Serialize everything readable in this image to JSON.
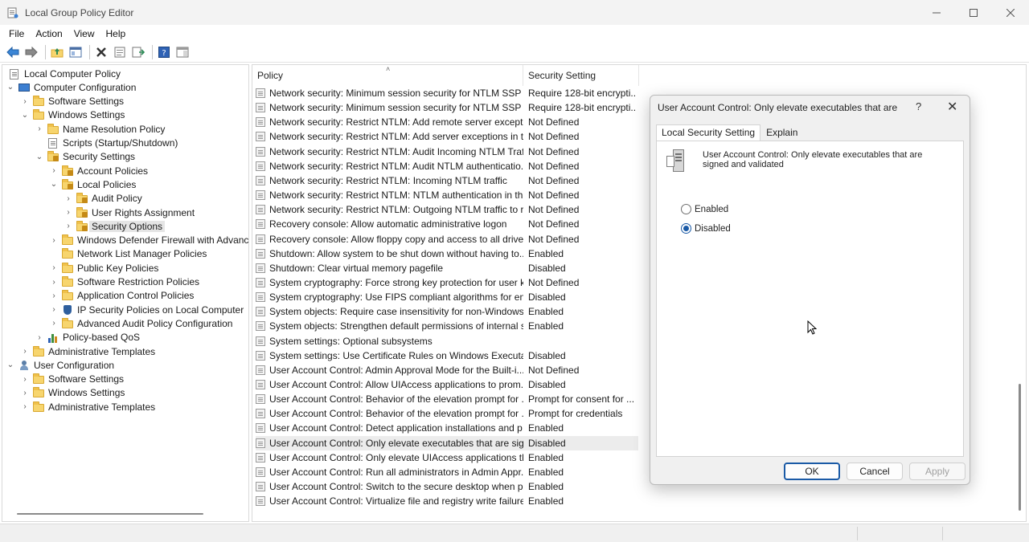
{
  "window": {
    "title": "Local Group Policy Editor"
  },
  "menu": [
    "File",
    "Action",
    "View",
    "Help"
  ],
  "tree": [
    {
      "label": "Local Computer Policy",
      "level": 0,
      "icon": "doc",
      "chev": ""
    },
    {
      "label": "Computer Configuration",
      "level": 1,
      "icon": "pc",
      "chev": "˅"
    },
    {
      "label": "Software Settings",
      "level": 2,
      "icon": "folder",
      "chev": "›"
    },
    {
      "label": "Windows Settings",
      "level": 2,
      "icon": "folder",
      "chev": "˅"
    },
    {
      "label": "Name Resolution Policy",
      "level": 3,
      "icon": "folder",
      "chev": "›"
    },
    {
      "label": "Scripts (Startup/Shutdown)",
      "level": 3,
      "icon": "doc",
      "chev": ""
    },
    {
      "label": "Security Settings",
      "level": 3,
      "icon": "lockfolder",
      "chev": "˅"
    },
    {
      "label": "Account Policies",
      "level": 4,
      "icon": "lockfolder",
      "chev": "›"
    },
    {
      "label": "Local Policies",
      "level": 4,
      "icon": "lockfolder",
      "chev": "˅"
    },
    {
      "label": "Audit Policy",
      "level": 5,
      "icon": "lockfolder",
      "chev": "›"
    },
    {
      "label": "User Rights Assignment",
      "level": 5,
      "icon": "lockfolder",
      "chev": "›"
    },
    {
      "label": "Security Options",
      "level": 5,
      "icon": "lockfolder",
      "chev": "›",
      "selected": true
    },
    {
      "label": "Windows Defender Firewall with Advance",
      "level": 4,
      "icon": "folder",
      "chev": "›"
    },
    {
      "label": "Network List Manager Policies",
      "level": 4,
      "icon": "folder",
      "chev": ""
    },
    {
      "label": "Public Key Policies",
      "level": 4,
      "icon": "folder",
      "chev": "›"
    },
    {
      "label": "Software Restriction Policies",
      "level": 4,
      "icon": "folder",
      "chev": "›"
    },
    {
      "label": "Application Control Policies",
      "level": 4,
      "icon": "folder",
      "chev": "›"
    },
    {
      "label": "IP Security Policies on Local Computer",
      "level": 4,
      "icon": "shield",
      "chev": "›"
    },
    {
      "label": "Advanced Audit Policy Configuration",
      "level": 4,
      "icon": "folder",
      "chev": "›"
    },
    {
      "label": "Policy-based QoS",
      "level": 3,
      "icon": "chart",
      "chev": "›"
    },
    {
      "label": "Administrative Templates",
      "level": 2,
      "icon": "folder",
      "chev": "›"
    },
    {
      "label": "User Configuration",
      "level": 1,
      "icon": "user",
      "chev": "˅"
    },
    {
      "label": "Software Settings",
      "level": 2,
      "icon": "folder",
      "chev": "›"
    },
    {
      "label": "Windows Settings",
      "level": 2,
      "icon": "folder",
      "chev": "›"
    },
    {
      "label": "Administrative Templates",
      "level": 2,
      "icon": "folder",
      "chev": "›"
    }
  ],
  "list": {
    "columns": [
      "Policy",
      "Security Setting"
    ],
    "rows": [
      {
        "policy": "Network security: Minimum session security for NTLM SSP ...",
        "setting": "Require 128-bit encrypti..."
      },
      {
        "policy": "Network security: Minimum session security for NTLM SSP ...",
        "setting": "Require 128-bit encrypti..."
      },
      {
        "policy": "Network security: Restrict NTLM: Add remote server excepti...",
        "setting": "Not Defined"
      },
      {
        "policy": "Network security: Restrict NTLM: Add server exceptions in t...",
        "setting": "Not Defined"
      },
      {
        "policy": "Network security: Restrict NTLM: Audit Incoming NTLM Traf...",
        "setting": "Not Defined"
      },
      {
        "policy": "Network security: Restrict NTLM: Audit NTLM authenticatio...",
        "setting": "Not Defined"
      },
      {
        "policy": "Network security: Restrict NTLM: Incoming NTLM traffic",
        "setting": "Not Defined"
      },
      {
        "policy": "Network security: Restrict NTLM: NTLM authentication in thi...",
        "setting": "Not Defined"
      },
      {
        "policy": "Network security: Restrict NTLM: Outgoing NTLM traffic to r...",
        "setting": "Not Defined"
      },
      {
        "policy": "Recovery console: Allow automatic administrative logon",
        "setting": "Not Defined"
      },
      {
        "policy": "Recovery console: Allow floppy copy and access to all drives...",
        "setting": "Not Defined"
      },
      {
        "policy": "Shutdown: Allow system to be shut down without having to...",
        "setting": "Enabled"
      },
      {
        "policy": "Shutdown: Clear virtual memory pagefile",
        "setting": "Disabled"
      },
      {
        "policy": "System cryptography: Force strong key protection for user k...",
        "setting": "Not Defined"
      },
      {
        "policy": "System cryptography: Use FIPS compliant algorithms for en...",
        "setting": "Disabled"
      },
      {
        "policy": "System objects: Require case insensitivity for non-Windows ...",
        "setting": "Enabled"
      },
      {
        "policy": "System objects: Strengthen default permissions of internal s...",
        "setting": "Enabled"
      },
      {
        "policy": "System settings: Optional subsystems",
        "setting": ""
      },
      {
        "policy": "System settings: Use Certificate Rules on Windows Executab...",
        "setting": "Disabled"
      },
      {
        "policy": "User Account Control: Admin Approval Mode for the Built-i...",
        "setting": "Not Defined"
      },
      {
        "policy": "User Account Control: Allow UIAccess applications to prom...",
        "setting": "Disabled"
      },
      {
        "policy": "User Account Control: Behavior of the elevation prompt for ...",
        "setting": "Prompt for consent for ..."
      },
      {
        "policy": "User Account Control: Behavior of the elevation prompt for ...",
        "setting": "Prompt for credentials"
      },
      {
        "policy": "User Account Control: Detect application installations and p...",
        "setting": "Enabled"
      },
      {
        "policy": "User Account Control: Only elevate executables that are sig...",
        "setting": "Disabled",
        "highlight": true
      },
      {
        "policy": "User Account Control: Only elevate UIAccess applications th...",
        "setting": "Enabled"
      },
      {
        "policy": "User Account Control: Run all administrators in Admin Appr...",
        "setting": "Enabled"
      },
      {
        "policy": "User Account Control: Switch to the secure desktop when pr...",
        "setting": "Enabled"
      },
      {
        "policy": "User Account Control: Virtualize file and registry write failure...",
        "setting": "Enabled"
      }
    ]
  },
  "dialog": {
    "title": "User Account Control: Only elevate executables that are s...",
    "help": "?",
    "close": "✕",
    "tabs": [
      "Local Security Setting",
      "Explain"
    ],
    "description": "User Account Control: Only elevate executables that are signed and validated",
    "options": [
      {
        "label": "Enabled",
        "checked": false
      },
      {
        "label": "Disabled",
        "checked": true
      }
    ],
    "buttons": {
      "ok": "OK",
      "cancel": "Cancel",
      "apply": "Apply"
    }
  },
  "colors": {
    "accent": "#1a5aa6",
    "selection": "#e5e5e5",
    "folder": "#f7d56e"
  }
}
